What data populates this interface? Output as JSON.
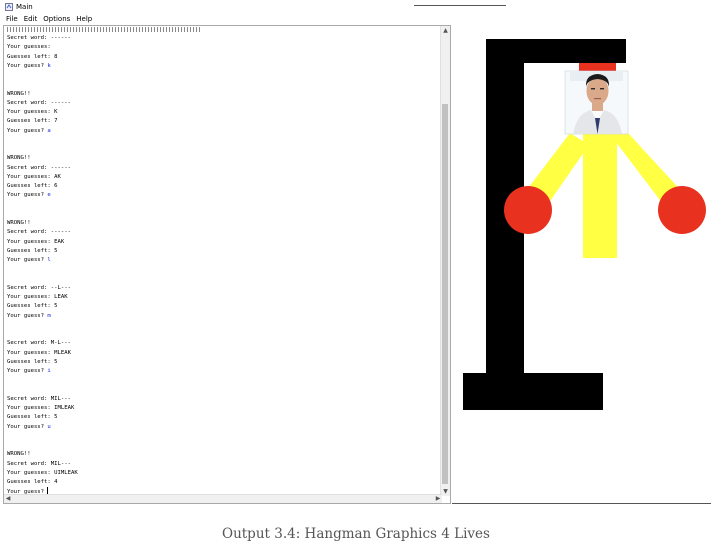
{
  "window": {
    "title": "Main",
    "icon": "python-idle-icon"
  },
  "menu": [
    "File",
    "Edit",
    "Options",
    "Help"
  ],
  "console": {
    "lines": [
      {
        "text": "Secret word: ------"
      },
      {
        "text": "Your guesses: "
      },
      {
        "text": "Guesses left: 8"
      },
      {
        "text": "Your guess? ",
        "input": "k"
      },
      {
        "text": ""
      },
      {
        "text": ""
      },
      {
        "text": "WRONG!!"
      },
      {
        "text": "Secret word: ------"
      },
      {
        "text": "Your guesses: K"
      },
      {
        "text": "Guesses left: 7"
      },
      {
        "text": "Your guess? ",
        "input": "a"
      },
      {
        "text": ""
      },
      {
        "text": ""
      },
      {
        "text": "WRONG!!"
      },
      {
        "text": "Secret word: ------"
      },
      {
        "text": "Your guesses: AK"
      },
      {
        "text": "Guesses left: 6"
      },
      {
        "text": "Your guess? ",
        "input": "e"
      },
      {
        "text": ""
      },
      {
        "text": ""
      },
      {
        "text": "WRONG!!"
      },
      {
        "text": "Secret word: ------"
      },
      {
        "text": "Your guesses: EAK"
      },
      {
        "text": "Guesses left: 5"
      },
      {
        "text": "Your guess? ",
        "input": "l"
      },
      {
        "text": ""
      },
      {
        "text": ""
      },
      {
        "text": "Secret word: --L---"
      },
      {
        "text": "Your guesses: LEAK"
      },
      {
        "text": "Guesses left: 5"
      },
      {
        "text": "Your guess? ",
        "input": "m"
      },
      {
        "text": ""
      },
      {
        "text": ""
      },
      {
        "text": "Secret word: M-L---"
      },
      {
        "text": "Your guesses: MLEAK"
      },
      {
        "text": "Guesses left: 5"
      },
      {
        "text": "Your guess? ",
        "input": "i"
      },
      {
        "text": ""
      },
      {
        "text": ""
      },
      {
        "text": "Secret word: MIL---"
      },
      {
        "text": "Your guesses: IMLEAK"
      },
      {
        "text": "Guesses left: 5"
      },
      {
        "text": "Your guess? ",
        "input": "u"
      },
      {
        "text": ""
      },
      {
        "text": ""
      },
      {
        "text": "WRONG!!"
      },
      {
        "text": "Secret word: MIL---"
      },
      {
        "text": "Your guesses: UIMLEAK"
      },
      {
        "text": "Guesses left: 4"
      },
      {
        "text": "Your guess? ",
        "cursor": true
      }
    ]
  },
  "graphics": {
    "colors": {
      "gallows": "#000000",
      "rope": "#e8321f",
      "body": "#ffff44",
      "hands": "#e8321f"
    },
    "head": "face-photo"
  },
  "caption": "Output 3.4: Hangman Graphics 4 Lives"
}
